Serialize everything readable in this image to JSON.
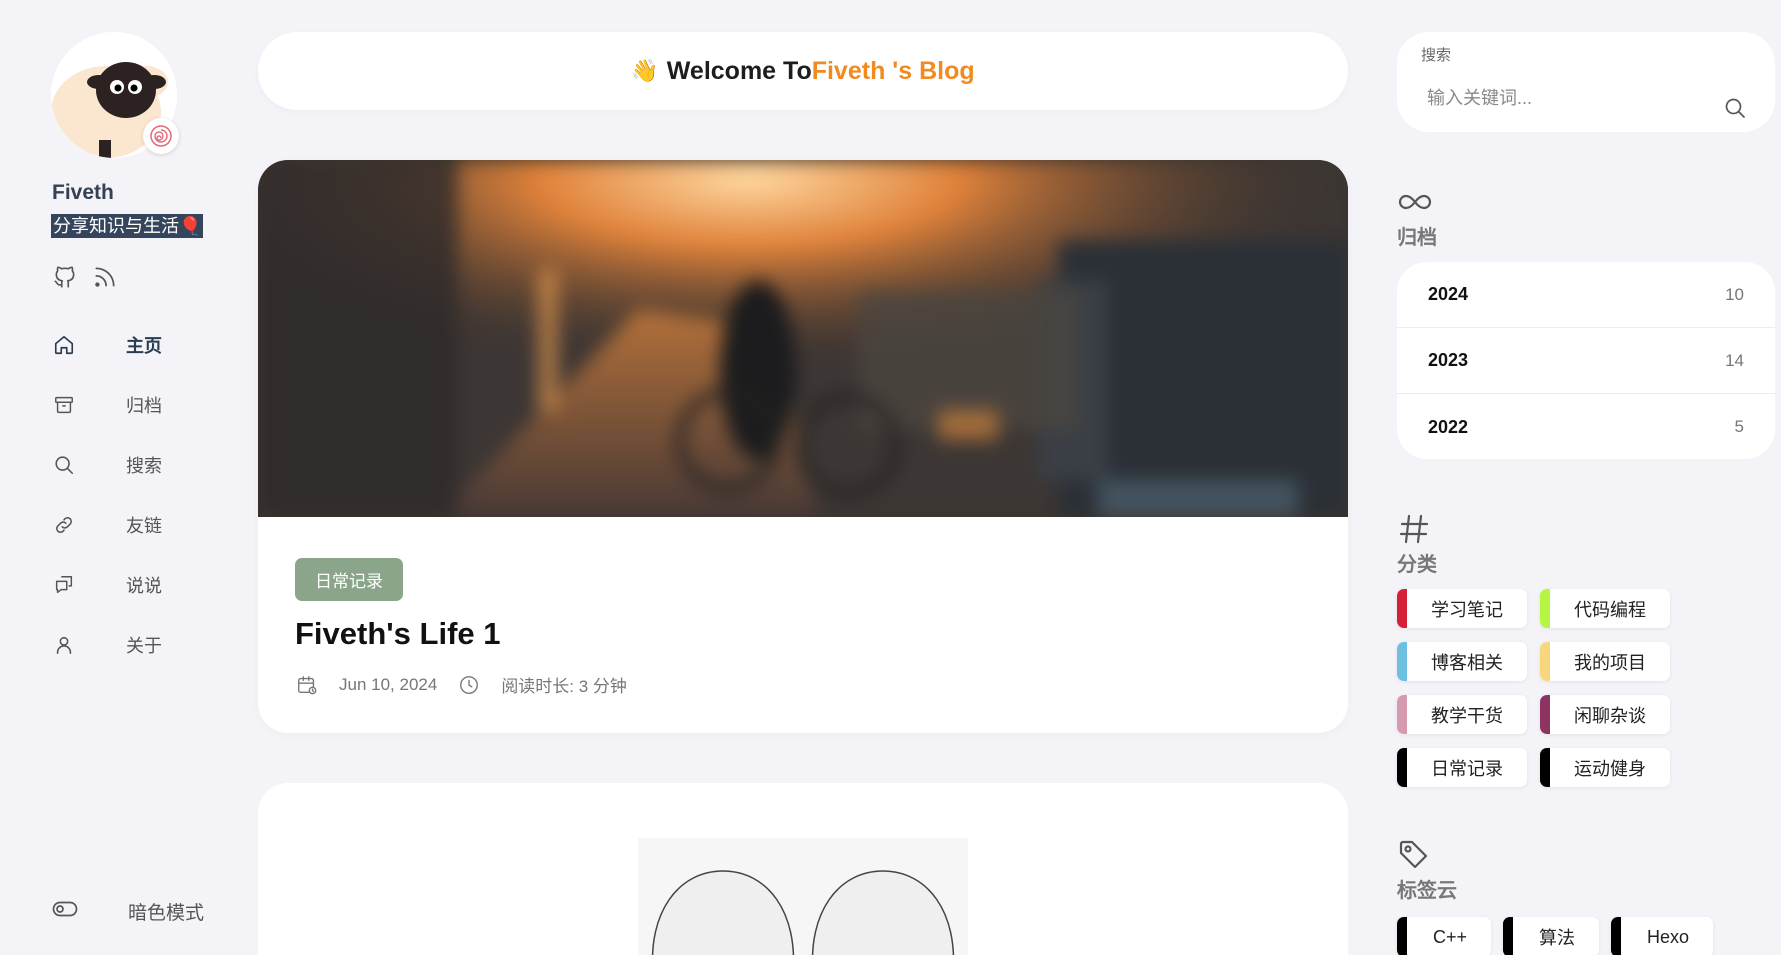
{
  "profile": {
    "name": "Fiveth",
    "motto": "分享知识与生活🎈",
    "avatar_icon": "sheep-avatar-icon"
  },
  "social": [
    {
      "icon": "github-icon"
    },
    {
      "icon": "rss-icon"
    }
  ],
  "nav": [
    {
      "label": "主页",
      "icon": "home-icon",
      "active": true
    },
    {
      "label": "归档",
      "icon": "archive-icon"
    },
    {
      "label": "搜索",
      "icon": "search-icon"
    },
    {
      "label": "友链",
      "icon": "link-icon"
    },
    {
      "label": "说说",
      "icon": "chat-icon"
    },
    {
      "label": "关于",
      "icon": "user-icon"
    }
  ],
  "dark_mode_label": "暗色模式",
  "welcome": {
    "emoji": "👋",
    "prefix": "Welcome To",
    "highlight": "Fiveth 's Blog"
  },
  "post": {
    "category": "日常记录",
    "title": "Fiveth's Life 1",
    "date": "Jun 10, 2024",
    "read_time": "阅读时长: 3 分钟"
  },
  "search": {
    "label": "搜索",
    "placeholder": "输入关键词..."
  },
  "archive": {
    "title": "归档",
    "items": [
      {
        "year": "2024",
        "count": "10"
      },
      {
        "year": "2023",
        "count": "14"
      },
      {
        "year": "2022",
        "count": "5"
      }
    ]
  },
  "categories": {
    "title": "分类",
    "items": [
      {
        "label": "学习笔记",
        "color": "#d6203a"
      },
      {
        "label": "代码编程",
        "color": "#b6f542"
      },
      {
        "label": "博客相关",
        "color": "#6fc0e0"
      },
      {
        "label": "我的项目",
        "color": "#f8d77c"
      },
      {
        "label": "教学干货",
        "color": "#d59aae"
      },
      {
        "label": "闲聊杂谈",
        "color": "#8e3462"
      },
      {
        "label": "日常记录",
        "color": "#000000"
      },
      {
        "label": "运动健身",
        "color": "#000000"
      }
    ]
  },
  "tags": {
    "title": "标签云",
    "items": [
      "C++",
      "算法",
      "Hexo"
    ]
  },
  "colors": {
    "accent": "#ef8b1f",
    "category_pill": "#8aa58a",
    "motto_bg": "#35465c"
  }
}
